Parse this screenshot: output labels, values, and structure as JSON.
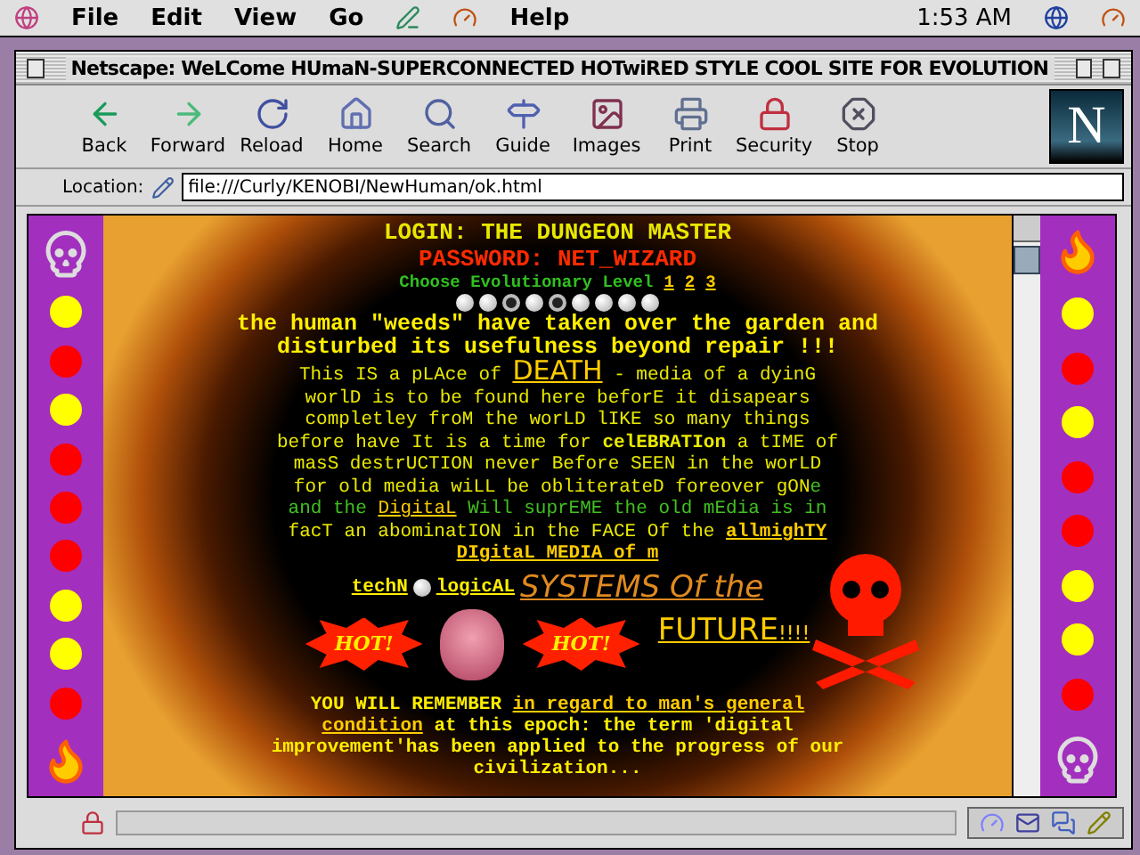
{
  "menubar": {
    "menus_before_icons": [
      "File",
      "Edit",
      "View",
      "Go"
    ],
    "menus_after_icons": [
      "Help"
    ],
    "clock": "1:53 AM"
  },
  "window": {
    "title": "Netscape: WeLCome HUmaN-SUPERCONNECTED HOTwiRED STYLE COOL SITE FOR EVOLUTION",
    "logo": "N"
  },
  "toolbar": [
    {
      "label": "Back",
      "kind": "back"
    },
    {
      "label": "Forward",
      "kind": "forward"
    },
    {
      "label": "Reload",
      "kind": "reload"
    },
    {
      "label": "Home",
      "kind": "home"
    },
    {
      "label": "Search",
      "kind": "search"
    },
    {
      "label": "Guide",
      "kind": "guide"
    },
    {
      "label": "Images",
      "kind": "images"
    },
    {
      "label": "Print",
      "kind": "print"
    },
    {
      "label": "Security",
      "kind": "security"
    },
    {
      "label": "Stop",
      "kind": "stop"
    }
  ],
  "location": {
    "label": "Location:",
    "value": "file:///Curly/KENOBI/NewHuman/ok.html"
  },
  "page": {
    "login": "LOGIN: THE DUNGEON MASTER",
    "password": "PASSWORD: NET_WIZARD",
    "level_label": "Choose Evolutionary Level",
    "level_links": [
      "1",
      "2",
      "3"
    ],
    "level_dots": [
      {
        "filled": true
      },
      {
        "filled": true
      },
      {
        "filled": false
      },
      {
        "filled": true
      },
      {
        "filled": false
      },
      {
        "filled": true
      },
      {
        "filled": true
      },
      {
        "filled": true
      },
      {
        "filled": true
      }
    ],
    "headline": "the human \"weeds\" have taken over the garden and disturbed its usefulness beyond repair !!!",
    "paragraph": [
      {
        "kind": "plain",
        "text": "This IS a pLAce of "
      },
      {
        "kind": "big-link",
        "text": "DEATH"
      },
      {
        "kind": "plain",
        "text": " - media of a dyinG worlD is to be found here beforE it disapears completley froM the worLD lIKE so many things before have It is a time for "
      },
      {
        "kind": "bold",
        "text": "celEBRATIon"
      },
      {
        "kind": "plain",
        "text": " a tIME of masS destrUCTION never Before SEEN in the worLD for old media wiLL be obliterateD foreover gON"
      },
      {
        "kind": "green",
        "text": "e and the "
      },
      {
        "kind": "link",
        "text": "DigitaL"
      },
      {
        "kind": "green",
        "text": " Will suprEME the old mEdia is in"
      },
      {
        "kind": "plain",
        "text": " facT an abominatION in the FACE Of the "
      },
      {
        "kind": "bold-link",
        "text": "allmighTY DIgitaL MEDIA of m"
      }
    ],
    "techno": {
      "before": "techN",
      "after": "logicAL",
      "systems": "SYSTEMS Of the"
    },
    "hot_badges": [
      "HOT!",
      "HOT!"
    ],
    "future": {
      "word": "FUTURE",
      "marks": "!!!!"
    },
    "closing": [
      {
        "kind": "bold",
        "text": "YOU WILL REMEMBER "
      },
      {
        "kind": "bold-link",
        "text": "in regard to man's general condition"
      },
      {
        "kind": "bold",
        "text": " at this epoch: the term 'digital improvement'has been applied to the progress of our civilization..."
      }
    ],
    "left_dots": [
      {
        "color": "#ffff00"
      },
      {
        "color": "#ff0000"
      },
      {
        "color": "#ffff00"
      },
      {
        "color": "#ff0000"
      },
      {
        "color": "#ff0000"
      },
      {
        "color": "#ff0000"
      },
      {
        "color": "#ffff00"
      },
      {
        "color": "#ffff00"
      },
      {
        "color": "#ff0000"
      }
    ],
    "right_dots": [
      {
        "color": "#ffff00"
      },
      {
        "color": "#ff0000"
      },
      {
        "color": "#ffff00"
      },
      {
        "color": "#ff0000"
      },
      {
        "color": "#ff0000"
      },
      {
        "color": "#ffff00"
      },
      {
        "color": "#ffff00"
      },
      {
        "color": "#ff0000"
      }
    ]
  }
}
